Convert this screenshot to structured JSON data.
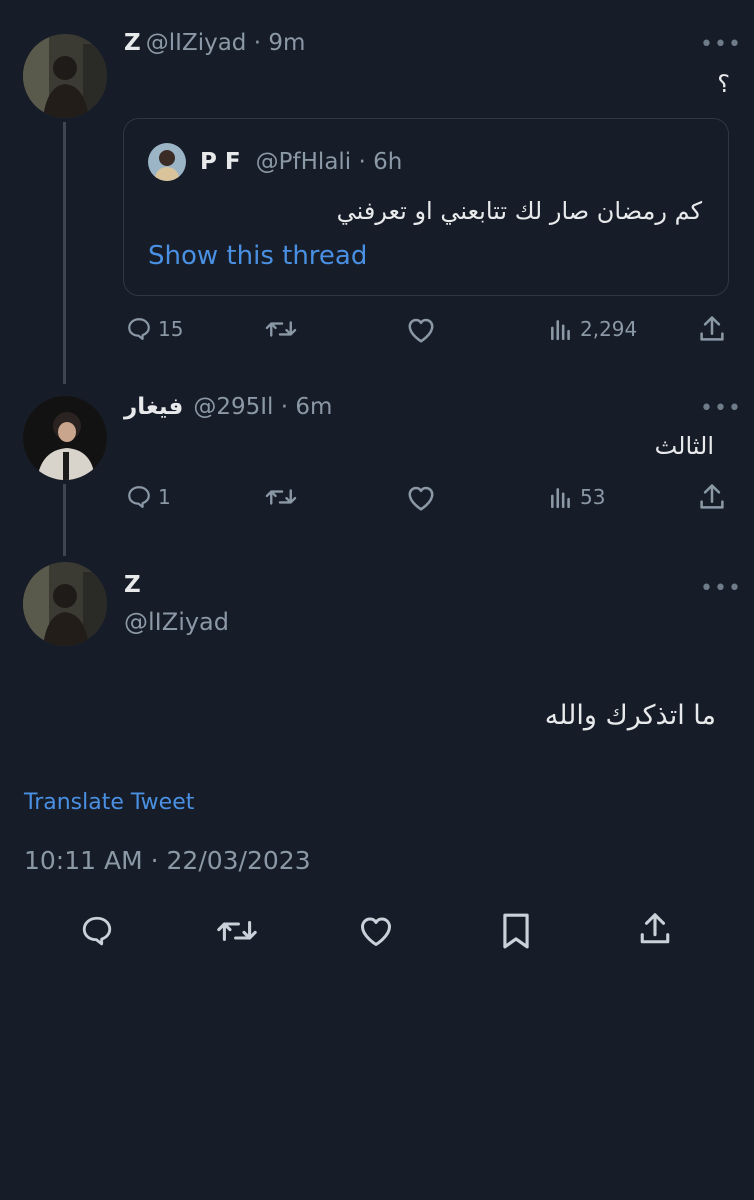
{
  "tweet1": {
    "name": "Z",
    "handle": "@lIZiyad",
    "time": "9m",
    "text": "؟",
    "quote": {
      "name": "P F",
      "handle": "@PfHlali",
      "time": "6h",
      "text": "كم رمضان صار لك تتابعني او تعرفني",
      "show_thread": "Show this thread"
    },
    "stats": {
      "replies": "15",
      "views": "2,294"
    }
  },
  "tweet2": {
    "name": "فيغار",
    "handle": "@295Il",
    "time": "6m",
    "text": "الثالث",
    "stats": {
      "replies": "1",
      "views": "53"
    }
  },
  "main_tweet": {
    "name": "Z",
    "handle": "@lIZiyad",
    "text": "ما اتذكرك والله",
    "translate": "Translate Tweet",
    "timestamp": "10:11 AM · 22/03/2023"
  },
  "icons": {
    "more": "more-icon",
    "reply": "reply-icon",
    "retweet": "retweet-icon",
    "like": "like-icon",
    "views": "views-icon",
    "share": "share-icon",
    "bookmark": "bookmark-icon"
  },
  "colors": {
    "background": "#161c28",
    "text": "#e7e9ea",
    "secondary": "#8b98a5",
    "link": "#4a90e2"
  }
}
